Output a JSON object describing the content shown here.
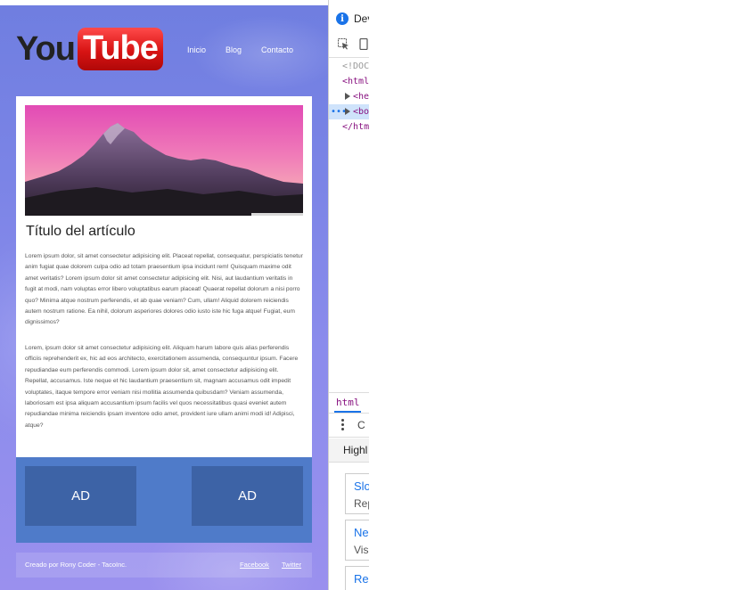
{
  "page": {
    "logo": {
      "part1": "You",
      "part2": "Tube"
    },
    "nav": [
      "Inicio",
      "Blog",
      "Contacto"
    ],
    "article": {
      "title": "Título del artículo",
      "paragraph1": "Lorem ipsum dolor, sit amet consectetur adipisicing elit. Placeat repellat, consequatur, perspiciatis tenetur anim fugiat quae dolorem culpa odio ad totam praesentium ipsa incidunt rem! Quisquam maxime odit amet veritatis? Lorem ipsum dolor sit amet consectetur adipisicing elit. Nisi, aut laudantium veritatis in fugit at modi, nam voluptas error libero voluptatibus earum placeat! Quaerat repellat dolorum a nisi porro quo? Minima atque nostrum perferendis, et ab quae veniam? Cum, ullam! Aliquid dolorem reiciendis autem nostrum ratione. Ea nihil, dolorum asperiores dolores odio iusto iste hic fuga atque! Fugiat, eum dignissimos?",
      "paragraph2": "Lorem, ipsum dolor sit amet consectetur adipisicing elit. Aliquam harum labore quis alias perferendis officiis reprehenderit ex, hic ad eos architecto, exercitationem assumenda, consequuntur ipsum. Facere repudiandae eum perferendis commodi. Lorem ipsum dolor sit, amet consectetur adipisicing elit. Repellat, accusamus. Iste neque et hic laudantium praesentium sit, magnam accusamus odit impedit voluptates, itaque tempore error veniam nisi mollitia assumenda quibusdam? Veniam assumenda, laboriosam est ipsa aliquam accusantium ipsum facilis vel quos necessitatibus quasi eveniet autem repudiandae minima reiciendis ipsam inventore odio amet, provident iure ullam animi modi id! Adipisci, atque?"
    },
    "ads": [
      "AD",
      "AD"
    ],
    "footer": {
      "credit": "Creado por Rony Coder - TacoInc.",
      "links": [
        "Facebook",
        "Twitter"
      ]
    }
  },
  "devtools": {
    "title": "Dev",
    "code": [
      "<!DOC",
      "<html",
      "<he",
      "<bo",
      "</htm"
    ],
    "breadcrumb": "html",
    "row2_label": "C",
    "row3_label": "Highl",
    "cards": [
      {
        "title": "Slo",
        "subtitle": "Rep"
      },
      {
        "title": "Ne",
        "subtitle": "Vis"
      },
      {
        "title": "Res",
        "subtitle": ""
      }
    ]
  },
  "colors": {
    "ads_band": "#4f7bc9",
    "ad_box": "#3d63a6",
    "logo_red": "#d81414",
    "devtools_accent": "#1a73e8"
  }
}
